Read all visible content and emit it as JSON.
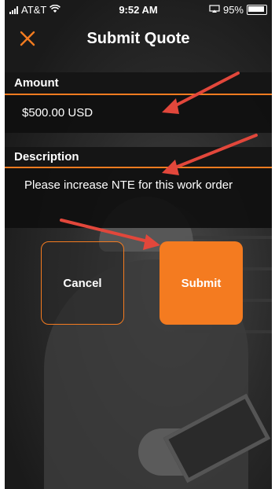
{
  "status_bar": {
    "carrier": "AT&T",
    "time": "9:52 AM",
    "battery": "95%"
  },
  "header": {
    "title": "Submit Quote",
    "close_icon": "close-icon"
  },
  "form": {
    "amount_label": "Amount",
    "amount_value": "$500.00 USD",
    "description_label": "Description",
    "description_value": "Please increase NTE for this work order"
  },
  "actions": {
    "cancel_label": "Cancel",
    "submit_label": "Submit"
  },
  "colors": {
    "accent": "#f47b20",
    "annotation_arrow": "#e2473b"
  }
}
